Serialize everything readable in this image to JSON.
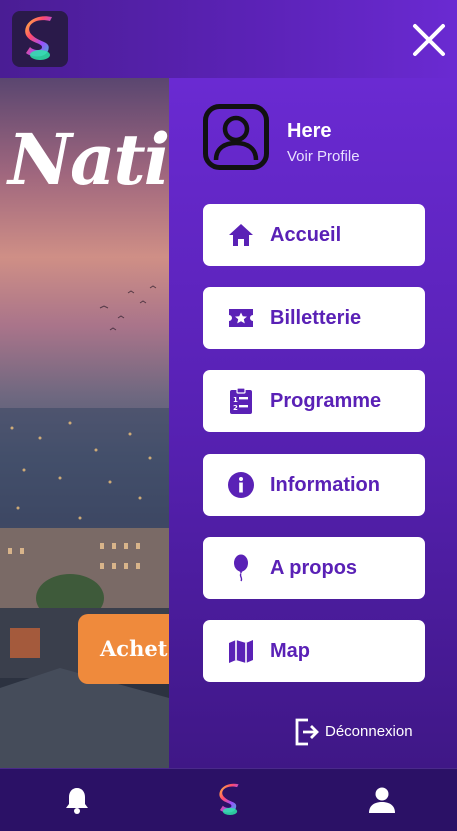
{
  "header": {
    "logo_icon": "app-logo-icon",
    "close_icon": "close-icon"
  },
  "hero": {
    "title": "Natio",
    "buy_label": "Achet"
  },
  "profile": {
    "name": "Here",
    "link_label": "Voir Profile",
    "avatar_icon": "user-avatar-icon"
  },
  "menu": {
    "items": [
      {
        "label": "Accueil",
        "icon": "home-icon"
      },
      {
        "label": "Billetterie",
        "icon": "ticket-icon"
      },
      {
        "label": "Programme",
        "icon": "clipboard-list-icon"
      },
      {
        "label": "Information",
        "icon": "info-icon"
      },
      {
        "label": "A propos",
        "icon": "balloon-icon"
      },
      {
        "label": "Map",
        "icon": "map-icon"
      }
    ]
  },
  "logout": {
    "label": "Déconnexion",
    "icon": "logout-icon"
  },
  "bottom_nav": {
    "items": [
      {
        "icon": "bell-icon"
      },
      {
        "icon": "app-logo-icon"
      },
      {
        "icon": "user-icon"
      }
    ]
  },
  "colors": {
    "accent": "#5a21b6",
    "drawer_top": "#6a2ad2",
    "drawer_bottom": "#3f1786",
    "button_orange": "#ef8a3c",
    "bottom_bar": "#2b1166"
  }
}
